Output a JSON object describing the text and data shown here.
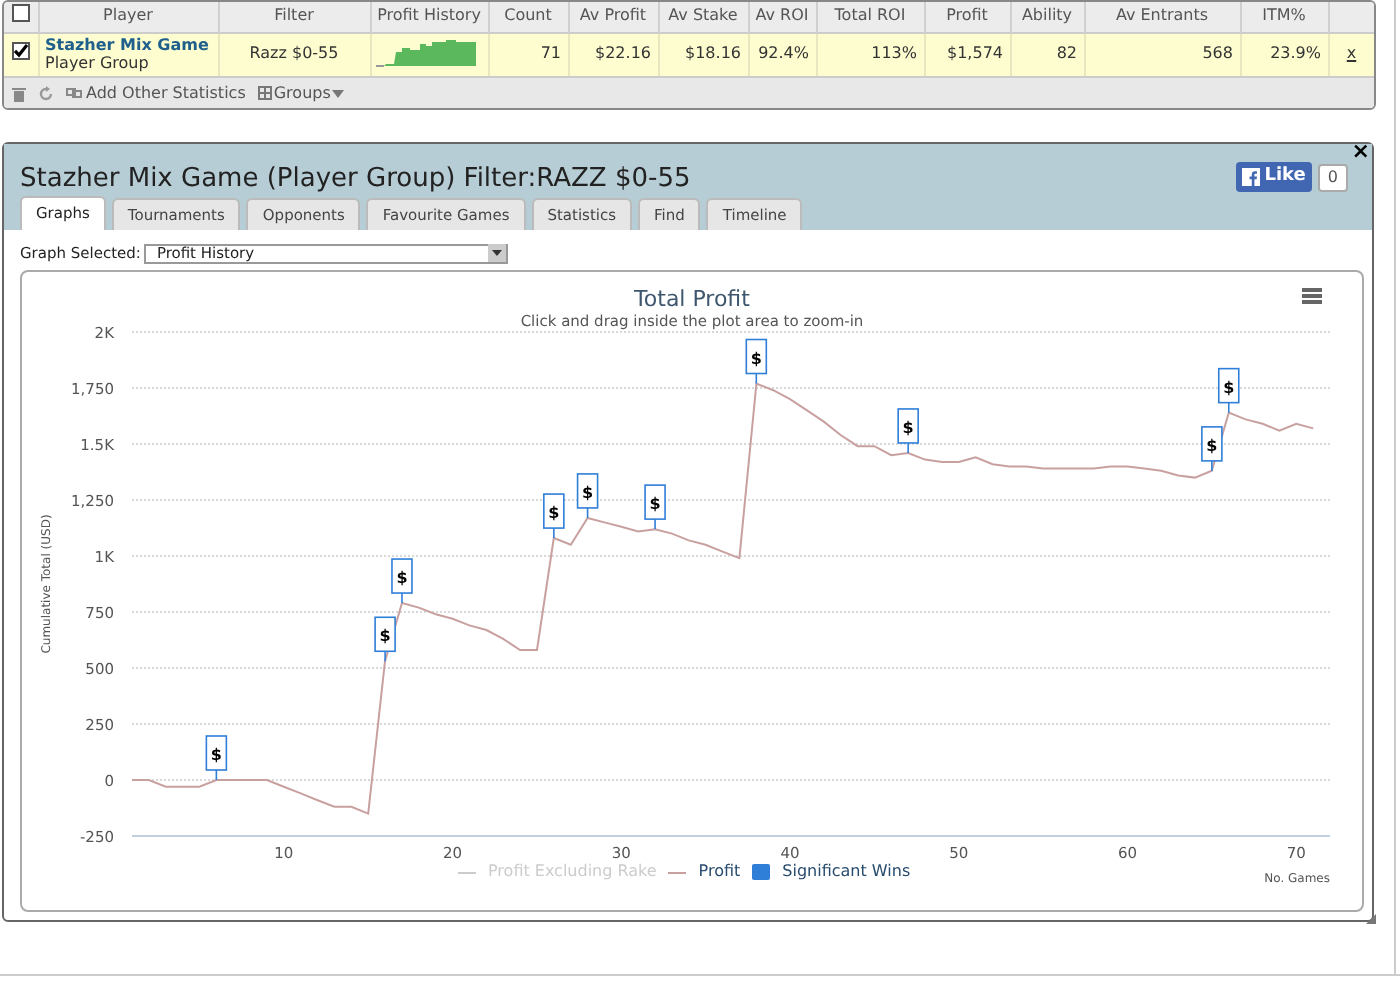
{
  "table": {
    "columns": [
      "Player",
      "Filter",
      "Profit History",
      "Count",
      "Av Profit",
      "Av Stake",
      "Av ROI",
      "Total ROI",
      "Profit",
      "Ability",
      "Av Entrants",
      "ITM%"
    ],
    "header_checked": false,
    "rows": [
      {
        "checked": true,
        "player_sub": "Player Group",
        "cells": [
          "Stazher Mix Game",
          "Razz $0-55",
          "",
          "71",
          "$22.16",
          "$18.16",
          "92.4%",
          "113%",
          "$1,574",
          "82",
          "568",
          "23.9%"
        ],
        "remove": "x"
      }
    ]
  },
  "toolbar": {
    "add_label": "Add Other Statistics",
    "groups_label": "Groups"
  },
  "panel": {
    "title": "Stazher Mix Game (Player Group) Filter:RAZZ $0-55",
    "like": {
      "label": "Like",
      "count": "0"
    },
    "close": "×",
    "tabs": [
      {
        "label": "Graphs",
        "selected": true
      },
      {
        "label": "Tournaments",
        "selected": false
      },
      {
        "label": "Opponents",
        "selected": false
      },
      {
        "label": "Favourite Games",
        "selected": false
      },
      {
        "label": "Statistics",
        "selected": false
      },
      {
        "label": "Find",
        "selected": false
      },
      {
        "label": "Timeline",
        "selected": false
      }
    ],
    "graph_select": {
      "label": "Graph Selected:",
      "value": "Profit History"
    },
    "legend": [
      {
        "kind": "line",
        "label": "Profit Excluding Rake",
        "hidden": true
      },
      {
        "kind": "series",
        "hidden": false
      },
      {
        "kind": "flag",
        "label": "Significant Wins",
        "color": "#2f7ed8",
        "hidden": false
      }
    ],
    "chart_data": {
      "type": "line",
      "title": "Total Profit",
      "subtitle": "Click and drag inside the plot area to zoom-in",
      "xlabel": "No. Games",
      "ylabel": "Cumulative Total (USD)",
      "grid": true,
      "x": [
        1,
        2,
        3,
        4,
        5,
        6,
        7,
        8,
        9,
        10,
        11,
        12,
        13,
        14,
        15,
        16,
        17,
        18,
        19,
        20,
        21,
        22,
        23,
        24,
        25,
        26,
        27,
        28,
        29,
        30,
        31,
        32,
        33,
        34,
        35,
        36,
        37,
        38,
        39,
        40,
        41,
        42,
        43,
        44,
        45,
        46,
        47,
        48,
        49,
        50,
        51,
        52,
        53,
        54,
        55,
        56,
        57,
        58,
        59,
        60,
        61,
        62,
        63,
        64,
        65,
        66,
        67,
        68,
        69,
        70,
        71
      ],
      "series": [
        {
          "name": "Profit",
          "color": "#c9a0a0",
          "values": [
            0,
            0,
            -30,
            -30,
            -30,
            0,
            0,
            0,
            0,
            -30,
            -60,
            -90,
            -120,
            -120,
            -150,
            530,
            790,
            770,
            740,
            720,
            690,
            670,
            630,
            580,
            580,
            1080,
            1050,
            1170,
            1150,
            1130,
            1110,
            1120,
            1100,
            1070,
            1050,
            1020,
            990,
            1770,
            1740,
            1700,
            1650,
            1600,
            1540,
            1490,
            1490,
            1450,
            1460,
            1430,
            1420,
            1420,
            1440,
            1410,
            1400,
            1400,
            1390,
            1390,
            1390,
            1390,
            1400,
            1400,
            1390,
            1380,
            1360,
            1350,
            1380,
            1640,
            1610,
            1590,
            1560,
            1590,
            1570
          ]
        }
      ],
      "xlim": [
        1,
        72
      ],
      "ylim": [
        -250,
        2000
      ],
      "xticks": [
        10,
        20,
        30,
        40,
        50,
        60,
        70
      ],
      "yticks": [
        -250,
        0,
        250,
        500,
        750,
        {
          "value": 1000,
          "label": "1K"
        },
        {
          "value": 1250,
          "label": "1,250"
        },
        {
          "value": 1500,
          "label": "1.5K"
        },
        {
          "value": 1750,
          "label": "1,750"
        },
        {
          "value": 2000,
          "label": "2K"
        }
      ],
      "annotations": [
        {
          "x": 6,
          "text": "$"
        },
        {
          "x": 16,
          "text": "$"
        },
        {
          "x": 17,
          "text": "$"
        },
        {
          "x": 26,
          "text": "$"
        },
        {
          "x": 28,
          "text": "$"
        },
        {
          "x": 32,
          "text": "$"
        },
        {
          "x": 38,
          "text": "$"
        },
        {
          "x": 47,
          "text": "$"
        },
        {
          "x": 65,
          "text": "$"
        },
        {
          "x": 66,
          "text": "$"
        }
      ]
    }
  }
}
